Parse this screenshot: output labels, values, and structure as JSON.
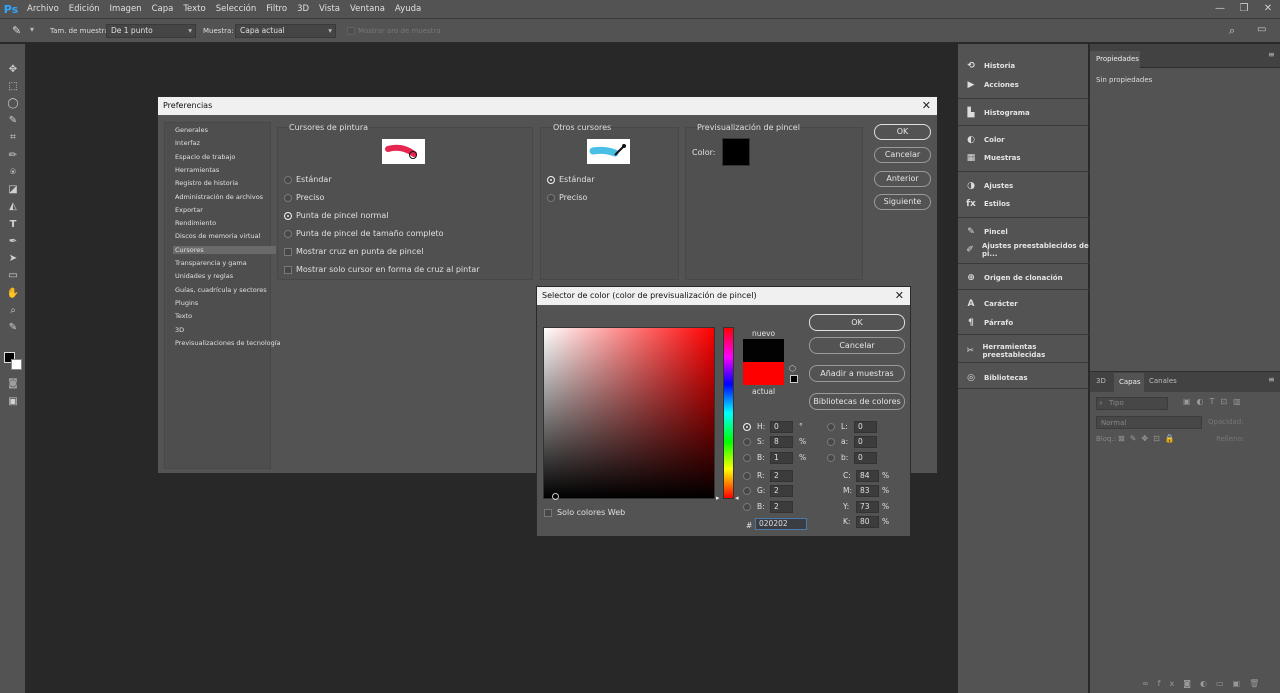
{
  "app": {
    "logo": "Ps"
  },
  "menu": [
    "Archivo",
    "Edición",
    "Imagen",
    "Capa",
    "Texto",
    "Selección",
    "Filtro",
    "3D",
    "Vista",
    "Ventana",
    "Ayuda"
  ],
  "window_controls": [
    "—",
    "❐",
    "✕"
  ],
  "options": {
    "sample_size_label": "Tam. de muestra:",
    "sample_size_value": "De 1 punto",
    "sample_label": "Muestra:",
    "sample_value": "Capa actual",
    "show_ring": "Mostrar aro de muestra"
  },
  "panels_left": [
    {
      "icon": "history-icon",
      "glyph": "⟲",
      "label": "Historia"
    },
    {
      "icon": "actions-icon",
      "glyph": "▶",
      "label": "Acciones"
    },
    {
      "icon": "histogram-icon",
      "glyph": "▙",
      "label": "Histograma"
    },
    {
      "icon": "color-icon",
      "glyph": "◐",
      "label": "Color"
    },
    {
      "icon": "swatches-icon",
      "glyph": "▦",
      "label": "Muestras"
    },
    {
      "icon": "adjustments-icon",
      "glyph": "◑",
      "label": "Ajustes"
    },
    {
      "icon": "styles-icon",
      "glyph": "fx",
      "label": "Estilos"
    },
    {
      "icon": "brush-icon",
      "glyph": "✎",
      "label": "Pincel"
    },
    {
      "icon": "brush-presets-icon",
      "glyph": "✐",
      "label": "Ajustes preestablecidos de pi..."
    },
    {
      "icon": "clone-source-icon",
      "glyph": "⊕",
      "label": "Origen de clonación"
    },
    {
      "icon": "character-icon",
      "glyph": "A",
      "label": "Carácter"
    },
    {
      "icon": "paragraph-icon",
      "glyph": "¶",
      "label": "Párrafo"
    },
    {
      "icon": "tool-presets-icon",
      "glyph": "✂",
      "label": "Herramientas preestablecidas"
    },
    {
      "icon": "libraries-icon",
      "glyph": "◎",
      "label": "Bibliotecas"
    }
  ],
  "properties": {
    "tab": "Propiedades",
    "text": "Sin propiedades"
  },
  "layers": {
    "tabs": [
      "3D",
      "Capas",
      "Canales"
    ],
    "search_placeholder": "Tipo",
    "blend": "Normal",
    "opacity": "Opacidad:",
    "lock": "Bloq.:",
    "fill": "Relleno:"
  },
  "prefs": {
    "title": "Preferencias",
    "categories": [
      "Generales",
      "Interfaz",
      "Espacio de trabajo",
      "Herramientas",
      "Registro de historia",
      "Administración de archivos",
      "Exportar",
      "Rendimiento",
      "Discos de memoria virtual",
      "Cursores",
      "Transparencia y gama",
      "Unidades y reglas",
      "Guías, cuadrícula y sectores",
      "Plugins",
      "Texto",
      "3D",
      "Previsualizaciones de tecnología"
    ],
    "selected_category": "Cursores",
    "painting_title": "Cursores de pintura",
    "painting_options": [
      "Estándar",
      "Preciso",
      "Punta de pincel normal",
      "Punta de pincel de tamaño completo"
    ],
    "painting_checks": [
      "Mostrar cruz en punta de pincel",
      "Mostrar solo cursor en forma de cruz al pintar"
    ],
    "other_title": "Otros cursores",
    "other_options": [
      "Estándar",
      "Preciso"
    ],
    "preview_title": "Previsualización de pincel",
    "color_label": "Color:",
    "buttons": [
      "OK",
      "Cancelar",
      "Anterior",
      "Siguiente"
    ]
  },
  "picker": {
    "title": "Selector de color (color de previsualización de pincel)",
    "new_label": "nuevo",
    "current_label": "actual",
    "buttons": [
      "OK",
      "Cancelar",
      "Añadir a muestras",
      "Bibliotecas de colores"
    ],
    "web_only": "Solo colores Web",
    "hsb": [
      {
        "k": "H:",
        "v": "0",
        "u": "°"
      },
      {
        "k": "S:",
        "v": "8",
        "u": "%"
      },
      {
        "k": "B:",
        "v": "1",
        "u": "%"
      }
    ],
    "rgb": [
      {
        "k": "R:",
        "v": "2"
      },
      {
        "k": "G:",
        "v": "2"
      },
      {
        "k": "B:",
        "v": "2"
      }
    ],
    "lab": [
      {
        "k": "L:",
        "v": "0"
      },
      {
        "k": "a:",
        "v": "0"
      },
      {
        "k": "b:",
        "v": "0"
      }
    ],
    "cmyk": [
      {
        "k": "C:",
        "v": "84",
        "u": "%"
      },
      {
        "k": "M:",
        "v": "83",
        "u": "%"
      },
      {
        "k": "Y:",
        "v": "73",
        "u": "%"
      },
      {
        "k": "K:",
        "v": "80",
        "u": "%"
      }
    ],
    "hex_label": "#",
    "hex": "020202",
    "colors": {
      "new": "#020202",
      "current": "#ff0000"
    }
  }
}
